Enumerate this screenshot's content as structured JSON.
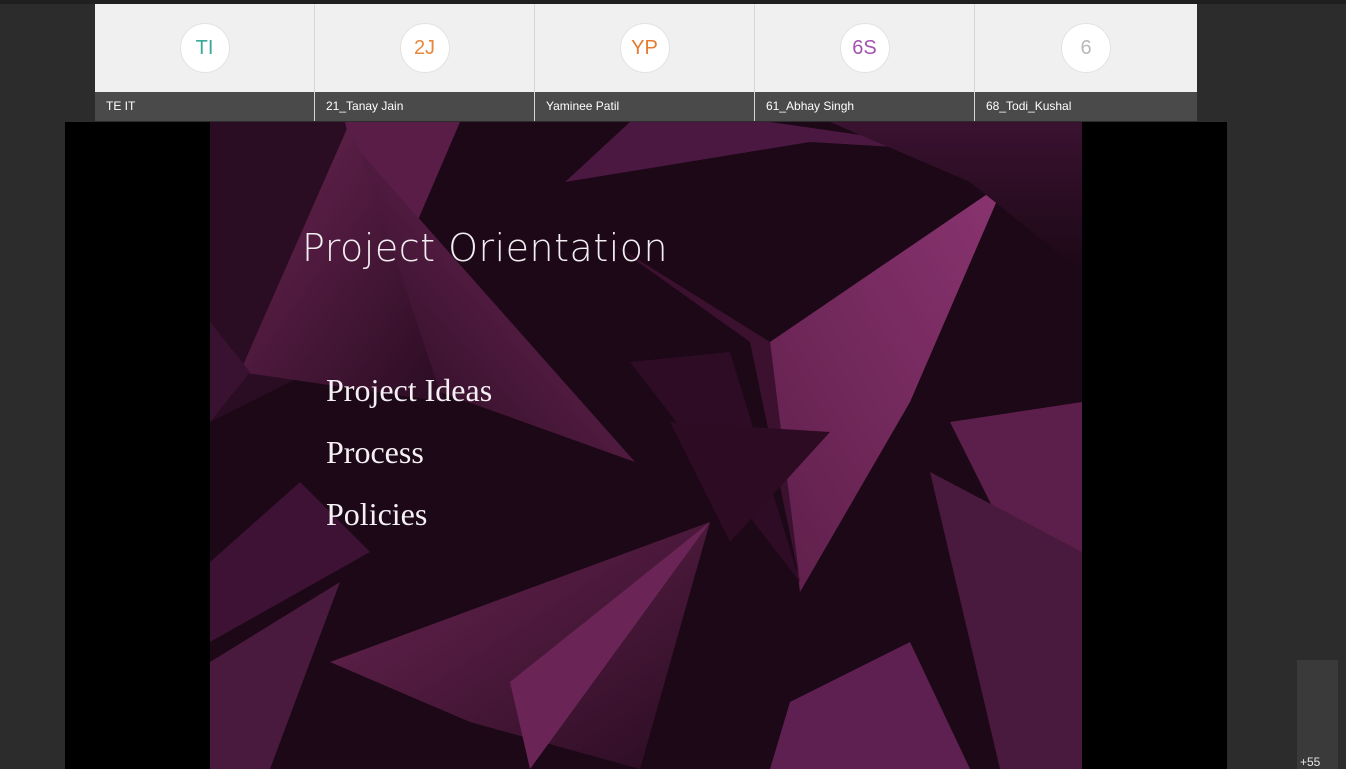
{
  "participants": [
    {
      "initials": "TI",
      "name": "TE IT",
      "color": "#3aa99a"
    },
    {
      "initials": "2J",
      "name": "21_Tanay Jain",
      "color": "#e8873a"
    },
    {
      "initials": "YP",
      "name": "Yaminee Patil",
      "color": "#e67a2e"
    },
    {
      "initials": "6S",
      "name": "61_Abhay Singh",
      "color": "#a452b0"
    },
    {
      "initials": "6",
      "name": "68_Todi_Kushal",
      "color": "#b9b9b9"
    }
  ],
  "slide": {
    "title": "Project Orientation",
    "bullets": [
      "Project Ideas",
      "Process",
      "Policies"
    ]
  },
  "overflow": {
    "more_participants": "+55"
  }
}
